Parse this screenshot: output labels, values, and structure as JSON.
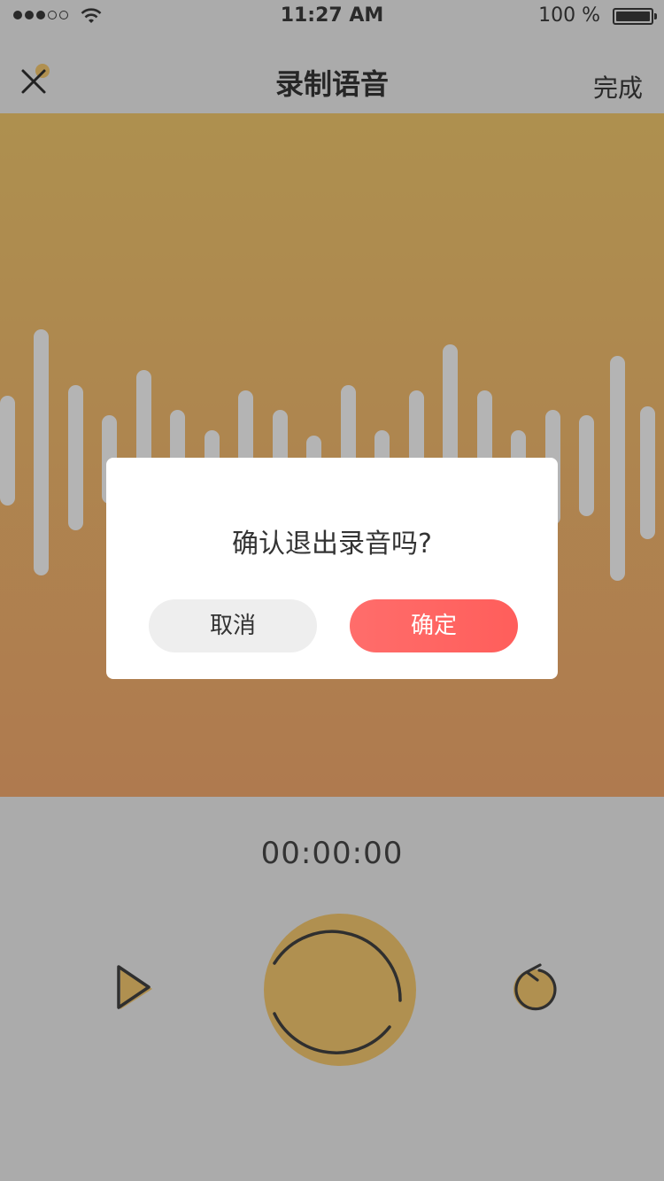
{
  "status_bar": {
    "time": "11:27 AM",
    "battery_text": "100 %",
    "signal_bars_filled": 3,
    "signal_bars_total": 5
  },
  "nav": {
    "title": "录制语音",
    "done_label": "完成",
    "close_icon": "close-icon"
  },
  "recorder": {
    "timer": "00:00:00",
    "play_icon": "play-icon",
    "record_icon": "record-button-icon",
    "redo_icon": "redo-icon"
  },
  "dialog": {
    "message": "确认退出录音吗?",
    "cancel_label": "取消",
    "confirm_label": "确定"
  },
  "colors": {
    "accent_gold": "#b09050",
    "confirm_red": "#ff6563",
    "background_gray": "#ababab"
  }
}
